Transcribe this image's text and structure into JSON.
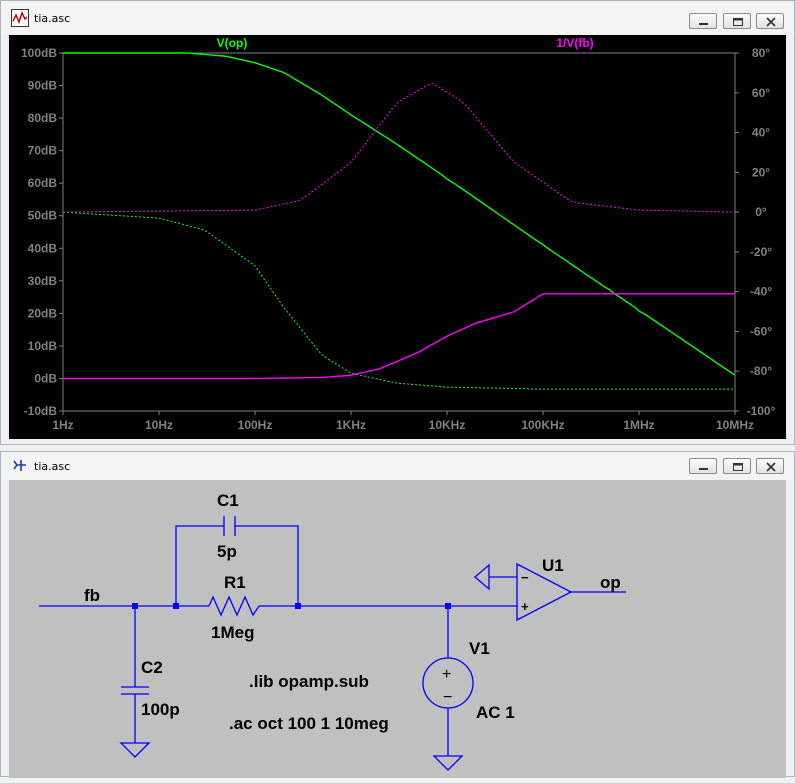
{
  "plot_window": {
    "title": "tia.asc",
    "traces": [
      {
        "name": "V(op)",
        "color": "#00ff00"
      },
      {
        "name": "1/V(fb)",
        "color": "#ff00ff"
      }
    ]
  },
  "chart_data": {
    "type": "line",
    "x_scale": "log",
    "x_ticks": [
      "1Hz",
      "10Hz",
      "100Hz",
      "1KHz",
      "10KHz",
      "100KHz",
      "1MHz",
      "10MHz"
    ],
    "xlim": [
      1,
      10000000
    ],
    "y_left_ticks": [
      "100dB",
      "90dB",
      "80dB",
      "70dB",
      "60dB",
      "50dB",
      "40dB",
      "30dB",
      "20dB",
      "10dB",
      "0dB",
      "-10dB"
    ],
    "ylim_left": [
      -10,
      100
    ],
    "y_right_ticks": [
      "80°",
      "60°",
      "40°",
      "20°",
      "0°",
      "-20°",
      "-40°",
      "-60°",
      "-80°",
      "-100°"
    ],
    "ylim_right": [
      -100,
      80
    ],
    "series": [
      {
        "name": "V(op)",
        "kind": "magnitude",
        "x": [
          1,
          10,
          20,
          50,
          100,
          200,
          500,
          1000,
          3000,
          10000,
          100000,
          500000,
          1000000,
          10000000
        ],
        "y": [
          100,
          100,
          100,
          99,
          97,
          94,
          87,
          81,
          72,
          61.5,
          41,
          27,
          21,
          1
        ]
      },
      {
        "name": "V(op)",
        "kind": "phase",
        "x": [
          1,
          10,
          30,
          100,
          200,
          500,
          1000,
          3000,
          10000,
          100000,
          10000000
        ],
        "y": [
          0,
          -3,
          -9,
          -27,
          -48,
          -72,
          -81,
          -86,
          -88,
          -89,
          -89
        ]
      },
      {
        "name": "1/V(fb)",
        "kind": "magnitude",
        "x": [
          1,
          100,
          500,
          1000,
          2000,
          5000,
          10000,
          20000,
          50000,
          100000,
          200000,
          500000,
          1000000,
          10000000
        ],
        "y": [
          0,
          0,
          0.3,
          1,
          3,
          8,
          13,
          17,
          20.5,
          26,
          26,
          26,
          26,
          26
        ]
      },
      {
        "name": "1/V(fb)",
        "kind": "phase",
        "x": [
          1,
          100,
          300,
          1000,
          3000,
          7000,
          15000,
          50000,
          200000,
          1000000,
          10000000
        ],
        "y": [
          0,
          1,
          6,
          25,
          55,
          65,
          55,
          25,
          5,
          1,
          0
        ]
      }
    ]
  },
  "schematic_window": {
    "title": "tia.asc",
    "labels": {
      "c1_name": "C1",
      "c1_value": "5p",
      "r1_name": "R1",
      "r1_value": "1Meg",
      "c2_name": "C2",
      "c2_value": "100p",
      "v1_name": "V1",
      "v1_value": "AC 1",
      "u1_name": "U1",
      "net_fb": "fb",
      "net_op": "op",
      "lib_directive": ".lib opamp.sub",
      "ac_directive": ".ac oct 100 1 10meg",
      "opamp_minus": "−",
      "opamp_plus": "+",
      "src_plus": "+",
      "src_minus": "−"
    },
    "colors": {
      "wire": "#0000ff",
      "background": "#c0c0c0",
      "text": "#000000"
    }
  }
}
